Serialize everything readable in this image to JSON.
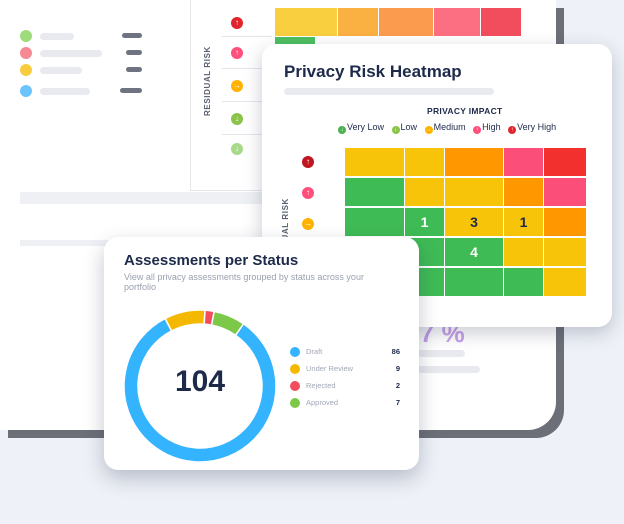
{
  "heatmap": {
    "title": "Privacy Risk Heatmap",
    "x_axis_label": "PRIVACY IMPACT",
    "y_axis_label": "RESIDUAL RISK",
    "legend": [
      {
        "label": "Very Low",
        "color": "#4caf50",
        "icon": "arrow-down-icon"
      },
      {
        "label": "Low",
        "color": "#8bc34a",
        "icon": "arrow-down-icon"
      },
      {
        "label": "Medium",
        "color": "#ffb300",
        "icon": "arrow-right-icon"
      },
      {
        "label": "High",
        "color": "#ff4f7b",
        "icon": "arrow-up-icon"
      },
      {
        "label": "Very High",
        "color": "#e0252d",
        "icon": "arrow-up-icon"
      }
    ],
    "cell_values": {
      "r3c2": "1",
      "r3c3": "3",
      "r3c4": "1",
      "r4c3": "4"
    }
  },
  "background_panel": {
    "y_axis_label": "RESIDUAL RISK"
  },
  "assessments": {
    "title": "Assessments per Status",
    "description": "View all privacy assessments grouped by status across your portfolio",
    "total": "104",
    "statuses": [
      {
        "label": "Draft",
        "count": "86",
        "color": "#34b3ff"
      },
      {
        "label": "Under Review",
        "count": "9",
        "color": "#f5b800"
      },
      {
        "label": "Rejected",
        "count": "2",
        "color": "#f24d5c"
      },
      {
        "label": "Approved",
        "count": "7",
        "color": "#7cc94a"
      }
    ]
  }
}
